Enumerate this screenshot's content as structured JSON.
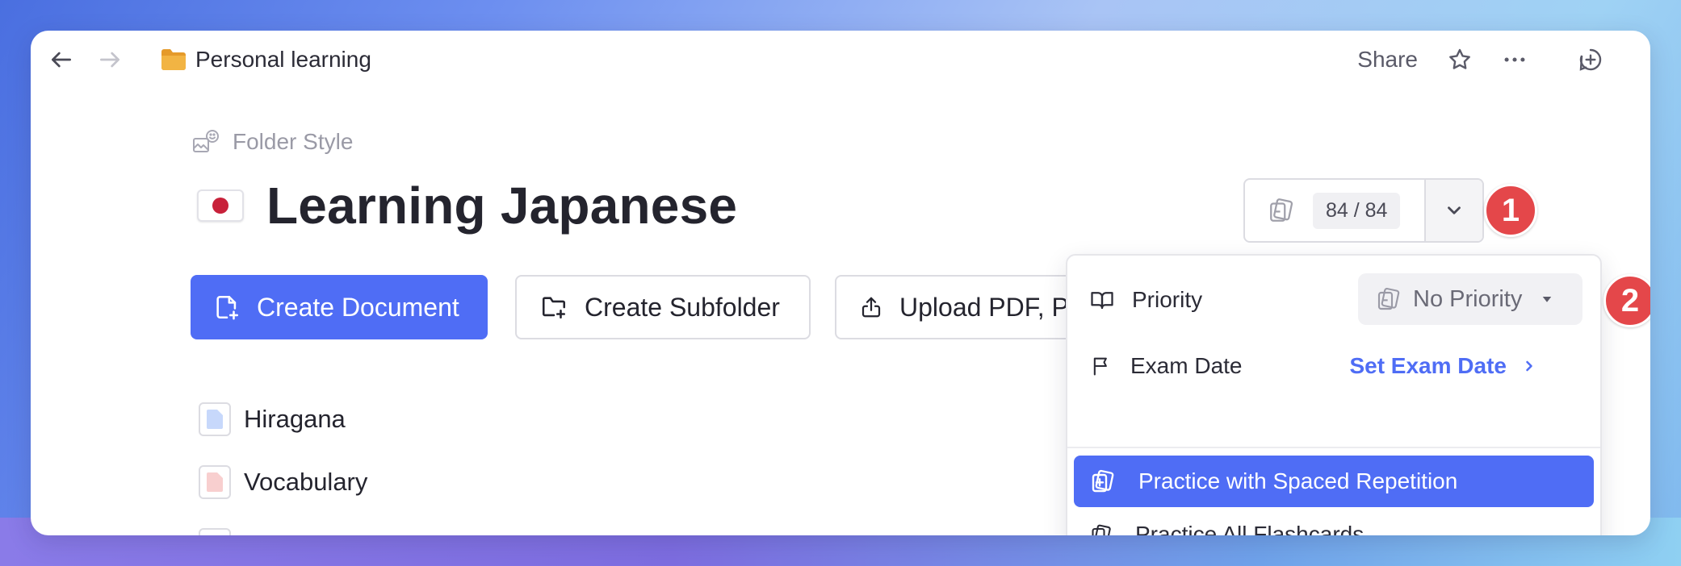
{
  "topbar": {
    "breadcrumb": "Personal learning",
    "share_label": "Share"
  },
  "page": {
    "style_label": "Folder Style",
    "title": "Learning Japanese"
  },
  "actions": {
    "create_document": "Create Document",
    "create_subfolder": "Create Subfolder",
    "upload": "Upload PDF, P"
  },
  "items": [
    {
      "label": "Hiragana",
      "color": "#c7d8fb"
    },
    {
      "label": "Vocabulary",
      "color": "#f8cfcf"
    }
  ],
  "counter": {
    "value": "84 / 84"
  },
  "badges": {
    "one": "1",
    "two": "2"
  },
  "dropdown": {
    "priority_label": "Priority",
    "priority_value": "No Priority",
    "exam_label": "Exam Date",
    "exam_link": "Set Exam Date",
    "practice_spaced": "Practice with Spaced Repetition",
    "practice_all": "Practice All Flashcards"
  },
  "colors": {
    "accent": "#4f6df5",
    "badge": "#e4474a"
  }
}
